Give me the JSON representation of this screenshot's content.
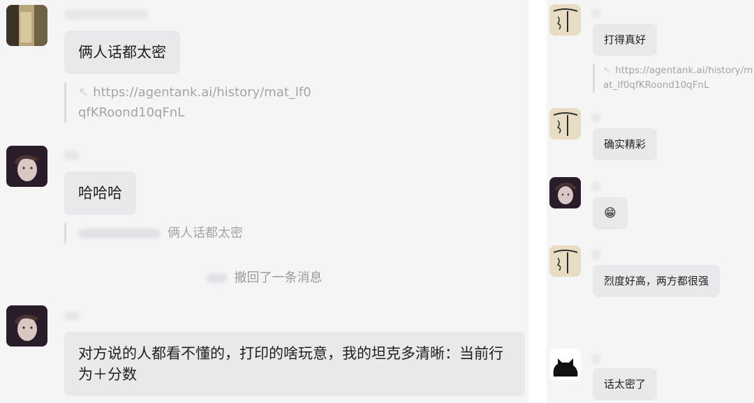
{
  "left": {
    "messages": [
      {
        "text": "俩人话都太密"
      },
      {
        "quote_link": "https://agentank.ai/history/mat_lf0qfKRoond10qFnL"
      },
      {
        "text": "哈哈哈"
      },
      {
        "quote_text": "俩人话都太密"
      },
      {
        "recall_text": "撤回了一条消息"
      },
      {
        "text": "对方说的人都看不懂的，打印的啥玩意，我的坦克多清晰：当前行为＋分数"
      }
    ]
  },
  "right": {
    "messages": [
      {
        "text": "打得真好"
      },
      {
        "quote_link": "https://agentank.ai/history/mat_lf0qfKRoond10qFnL"
      },
      {
        "text": "确实精彩"
      },
      {
        "emoji": "😁"
      },
      {
        "text": "烈度好高，两方都很强"
      },
      {
        "text": "话太密了"
      }
    ]
  },
  "colors": {
    "panel_bg": "#f5f5f6",
    "bubble_bg": "#e9e9ec",
    "quote_text": "#a4a4a8"
  },
  "icons": {
    "link": "link-icon"
  }
}
